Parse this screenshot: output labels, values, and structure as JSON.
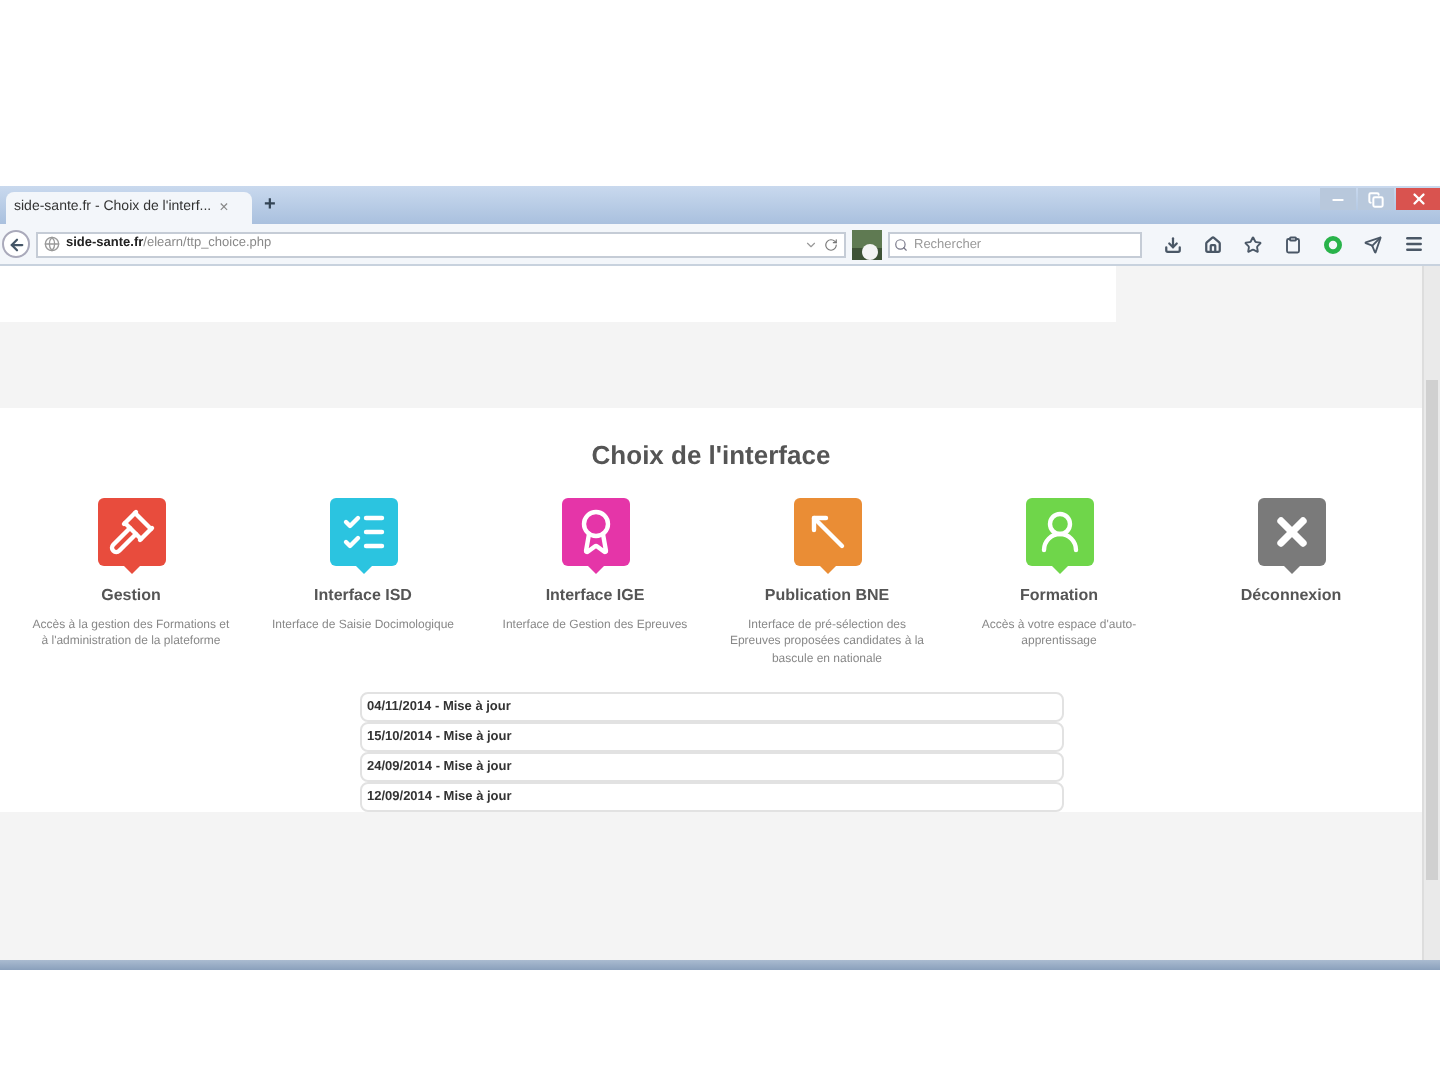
{
  "browser": {
    "tab_title": "side-sante.fr - Choix de l'interf...",
    "tab_close": "×",
    "new_tab": "+",
    "url_host": "side-sante.fr",
    "url_path": "/elearn/ttp_choice.php",
    "search_placeholder": "Rechercher"
  },
  "page": {
    "title": "Choix de l'interface",
    "tiles": [
      {
        "kind": "admin",
        "color": "#e84c3d",
        "label": "Gestion",
        "description": "Accès à la gestion des Formations et à l'administration de la plateforme"
      },
      {
        "kind": "checklist",
        "color": "#2bc4e0",
        "label": "Interface ISD",
        "description": "Interface de Saisie Docimologique"
      },
      {
        "kind": "medal",
        "color": "#e535a8",
        "label": "Interface IGE",
        "description": "Interface de Gestion des Epreuves"
      },
      {
        "kind": "publish",
        "color": "#ea8d35",
        "label": "Publication BNE",
        "description": "Interface de pré-sélection des Epreuves proposées candidates à la bascule en nationale"
      },
      {
        "kind": "person",
        "color": "#6fd64a",
        "label": "Formation",
        "description": "Accès à votre espace d'auto-apprentissage"
      },
      {
        "kind": "logout",
        "color": "#7a7a7a",
        "label": "Déconnexion"
      }
    ],
    "updates": [
      "04/11/2014 - Mise à jour",
      "15/10/2014 - Mise à jour",
      "24/09/2014 - Mise à jour",
      "12/09/2014 - Mise à jour"
    ]
  }
}
